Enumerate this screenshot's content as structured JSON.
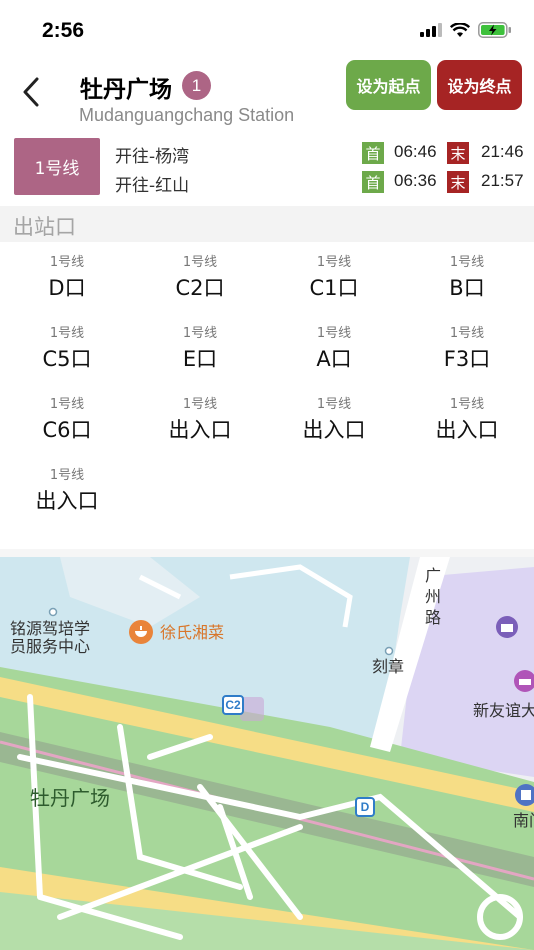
{
  "status_bar": {
    "time": "2:56"
  },
  "header": {
    "station_name": "牡丹广场",
    "badge": "1",
    "station_en": "Mudanguangchang Station",
    "set_start": "设为起点",
    "set_end": "设为终点"
  },
  "line": {
    "name": "1号线",
    "directions": [
      {
        "label": "开往-杨湾",
        "first_tag": "首",
        "first_time": "06:46",
        "last_tag": "末",
        "last_time": "21:46"
      },
      {
        "label": "开往-红山",
        "first_tag": "首",
        "first_time": "06:36",
        "last_tag": "末",
        "last_time": "21:57"
      }
    ]
  },
  "exits_section": {
    "title": "出站口"
  },
  "exits": [
    {
      "line": "1号线",
      "name": "D口"
    },
    {
      "line": "1号线",
      "name": "C2口"
    },
    {
      "line": "1号线",
      "name": "C1口"
    },
    {
      "line": "1号线",
      "name": "B口"
    },
    {
      "line": "1号线",
      "name": "C5口"
    },
    {
      "line": "1号线",
      "name": "E口"
    },
    {
      "line": "1号线",
      "name": "A口"
    },
    {
      "line": "1号线",
      "name": "F3口"
    },
    {
      "line": "1号线",
      "name": "C6口"
    },
    {
      "line": "1号线",
      "name": "出入口"
    },
    {
      "line": "1号线",
      "name": "出入口"
    },
    {
      "line": "1号线",
      "name": "出入口"
    },
    {
      "line": "1号线",
      "name": "出入口"
    }
  ],
  "map": {
    "labels": {
      "driving_school_1": "铭源驾培学",
      "driving_school_2": "员服务中心",
      "restaurant": "徐氏湘菜",
      "engraving": "刻章",
      "road": "广州路",
      "mall": "新友谊大",
      "square": "牡丹广场",
      "south": "南门",
      "exit_c2": "C2",
      "exit_d": "D"
    }
  },
  "colors": {
    "line1": "#ad6585",
    "start_green": "#6da94a",
    "end_red": "#a62424"
  }
}
